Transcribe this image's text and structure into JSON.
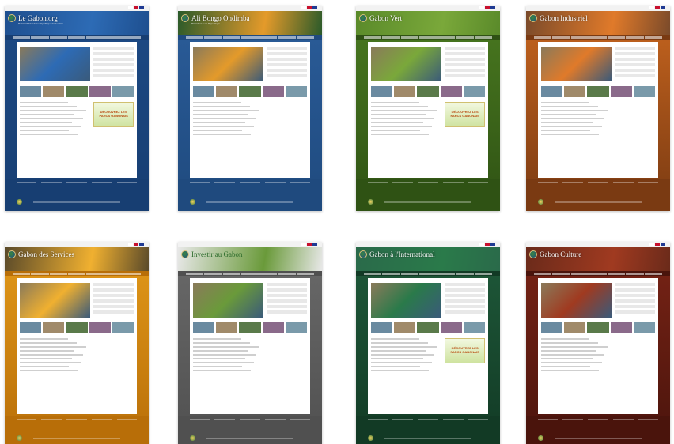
{
  "sites": [
    {
      "title": "Le Gabon.org",
      "subtitle": "Portail Officiel de la République Gabonaise",
      "promo": "DÉCOUVREZ LES PARCS GABONAIS",
      "colors": {
        "banner": "#1e4f8f",
        "page": "#1d4a85",
        "footer": "#173e72",
        "accent": "#2d6bb5"
      }
    },
    {
      "title": "Ali Bongo Ondimba",
      "subtitle": "Président de la République",
      "promo": "",
      "colors": {
        "banner": "#2a5a2a",
        "page": "#2b5d9a",
        "footer": "#1f4a7e",
        "accent": "#e49a2a"
      }
    },
    {
      "title": "Gabon Vert",
      "subtitle": "",
      "promo": "DÉCOUVREZ LES PARCS GABONAIS",
      "colors": {
        "banner": "#5a8a2a",
        "page": "#4a7a20",
        "footer": "#2f5214",
        "accent": "#7aa83a"
      }
    },
    {
      "title": "Gabon Industriel",
      "subtitle": "",
      "promo": "",
      "colors": {
        "banner": "#7a4a2a",
        "page": "#c8661f",
        "footer": "#7a3a12",
        "accent": "#e07a2a"
      }
    },
    {
      "title": "Gabon des Services",
      "subtitle": "",
      "promo": "",
      "colors": {
        "banner": "#5a4a2a",
        "page": "#e39a1a",
        "footer": "#b86e08",
        "accent": "#f0b030"
      }
    },
    {
      "title": "Investir au Gabon",
      "subtitle": "",
      "promo": "",
      "colors": {
        "banner": "#e8e8e8",
        "page": "#6a6a6a",
        "footer": "#505050",
        "accent": "#6a9a3a"
      }
    },
    {
      "title": "Gabon à l'International",
      "subtitle": "",
      "promo": "DÉCOUVREZ LES PARCS GABONAIS",
      "colors": {
        "banner": "#2a6a4a",
        "page": "#1f5a3a",
        "footer": "#123a25",
        "accent": "#2a7a4a"
      }
    },
    {
      "title": "Gabon Culture",
      "subtitle": "",
      "promo": "",
      "colors": {
        "banner": "#6a2a1a",
        "page": "#7a2416",
        "footer": "#4a140c",
        "accent": "#a03a20"
      }
    }
  ]
}
